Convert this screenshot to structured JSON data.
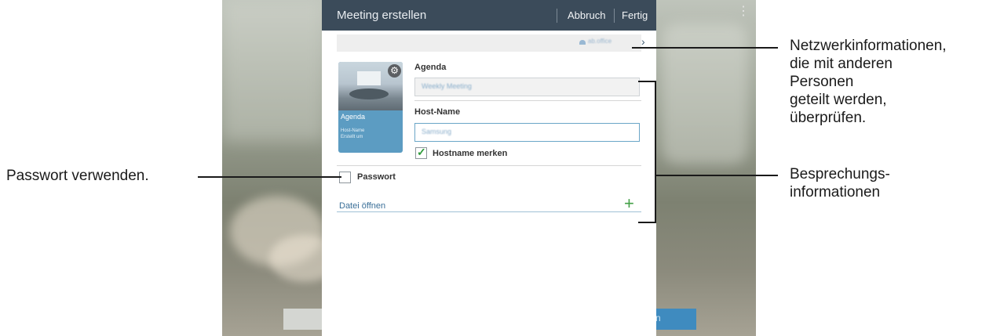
{
  "dialog": {
    "title": "Meeting erstellen",
    "cancel_label": "Abbruch",
    "done_label": "Fertig",
    "card": {
      "title": "Agenda",
      "line1": "Host-Name",
      "line2": "Erstellt um"
    },
    "agenda": {
      "label": "Agenda",
      "value": "Weekly Meeting"
    },
    "host": {
      "label": "Host-Name",
      "value": "Samsung"
    },
    "remember_host_label": "Hostname merken",
    "remember_host_checked": true,
    "password_label": "Passwort",
    "password_checked": false,
    "open_file_label": "Datei öffnen",
    "network_name": "ab.office"
  },
  "background": {
    "button_right_label": "n"
  },
  "callouts": {
    "password": "Passwort verwenden.",
    "network": [
      "Netzwerkinformationen,",
      "die mit anderen",
      "Personen",
      "geteilt werden,",
      "überprüfen."
    ],
    "meeting": [
      "Besprechungs-",
      "informationen"
    ]
  },
  "colors": {
    "titlebar": "#3b4b5a",
    "accent": "#5c9cc2",
    "check": "#2e9b3b",
    "plus": "#43a047"
  }
}
